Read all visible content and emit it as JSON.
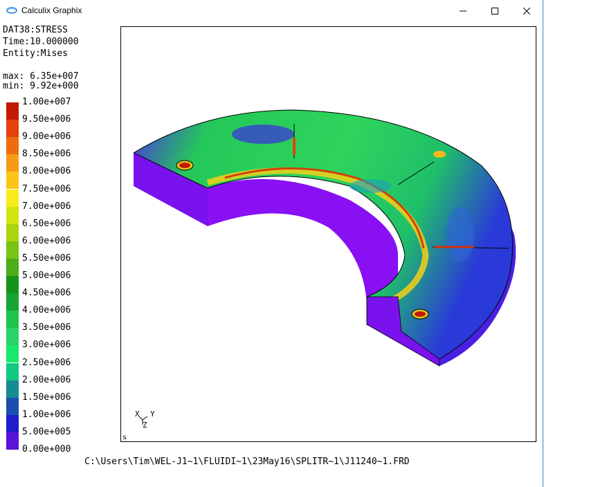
{
  "window": {
    "title": "Calculix Graphix",
    "controls": {
      "minimize": "minimize",
      "maximize": "maximize",
      "close": "close"
    }
  },
  "info": {
    "dataset": "DAT38:STRESS",
    "time": "Time:10.000000",
    "entity": "Entity:Mises",
    "max": "max: 6.35e+007",
    "min": "min: 9.92e+000"
  },
  "legend": {
    "entries": [
      {
        "label": "1.00e+007",
        "color": "#c41a05"
      },
      {
        "label": "9.50e+006",
        "color": "#e2430c"
      },
      {
        "label": "9.00e+006",
        "color": "#f06b10"
      },
      {
        "label": "8.50e+006",
        "color": "#f89a14"
      },
      {
        "label": "8.00e+006",
        "color": "#fbc518"
      },
      {
        "label": "7.50e+006",
        "color": "#f7ec1a"
      },
      {
        "label": "7.00e+006",
        "color": "#d2e50f"
      },
      {
        "label": "6.50e+006",
        "color": "#a9d510"
      },
      {
        "label": "6.00e+006",
        "color": "#78c314"
      },
      {
        "label": "5.50e+006",
        "color": "#4aae16"
      },
      {
        "label": "5.00e+006",
        "color": "#16941a"
      },
      {
        "label": "4.50e+006",
        "color": "#15a532"
      },
      {
        "label": "4.00e+006",
        "color": "#1cc44e"
      },
      {
        "label": "3.50e+006",
        "color": "#2ad466"
      },
      {
        "label": "3.00e+006",
        "color": "#18e86c"
      },
      {
        "label": "2.50e+006",
        "color": "#12c883"
      },
      {
        "label": "2.00e+006",
        "color": "#158b94"
      },
      {
        "label": "1.50e+006",
        "color": "#1a4fb0"
      },
      {
        "label": "1.00e+006",
        "color": "#1f1cc8"
      },
      {
        "label": "5.00e+005",
        "color": "#5a14d8"
      },
      {
        "label": "0.00e+000",
        "color": "#8f0ff0"
      }
    ]
  },
  "viewport": {
    "axes": {
      "x": "X",
      "y": "Y",
      "z": "Z"
    },
    "corner_label": "s"
  },
  "status": {
    "file_path": "C:\\Users\\Tim\\WEL-J1~1\\FLUIDI~1\\23May16\\SPLITR~1\\J11240~1.FRD"
  },
  "colors": {
    "purple": "#8a12f0",
    "blue": "#3b2ee0",
    "green": "#28c85a",
    "red": "#c41a05"
  }
}
